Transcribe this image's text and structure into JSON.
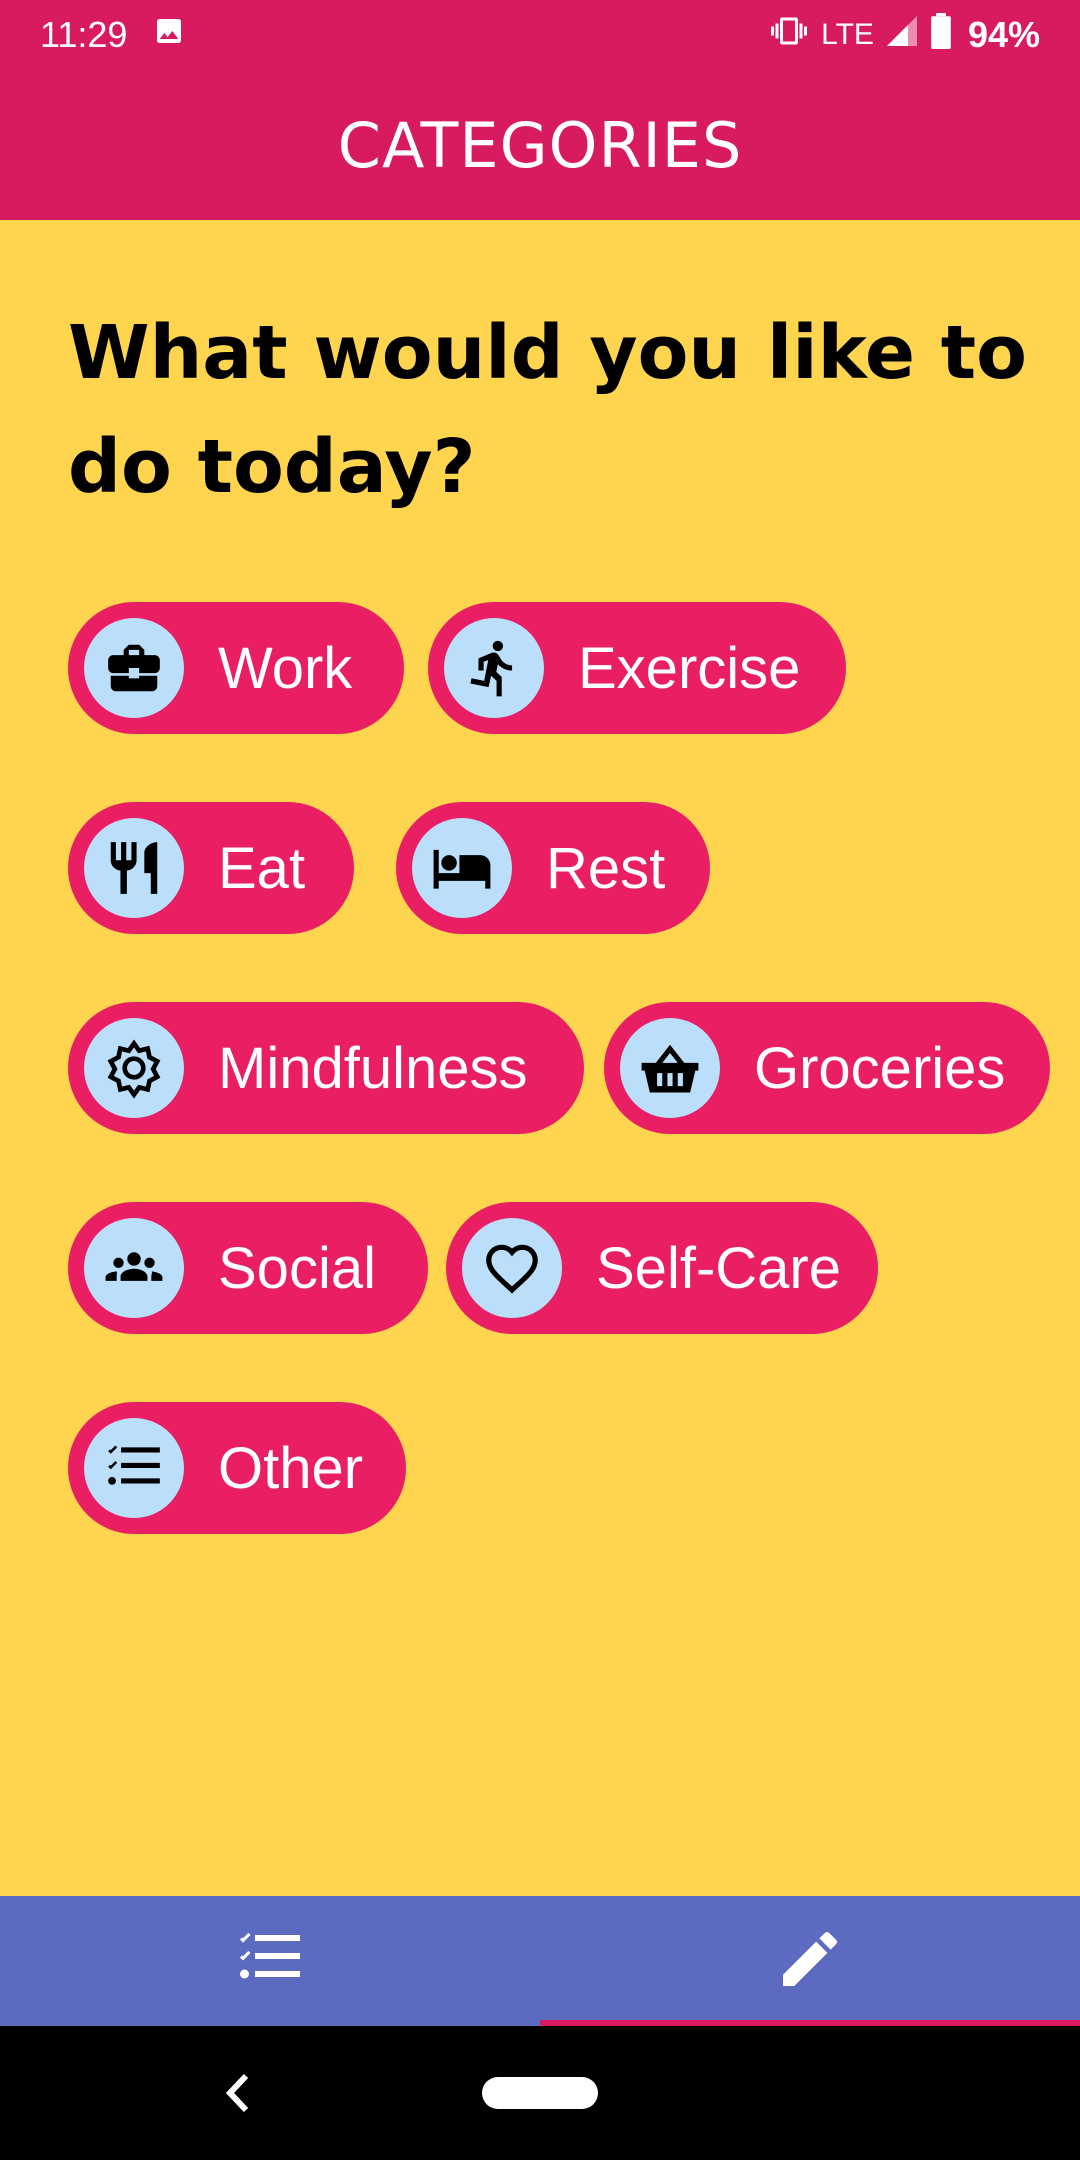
{
  "status_bar": {
    "time": "11:29",
    "network": "LTE",
    "battery": "94%",
    "icons": [
      "image-icon",
      "vibrate-icon",
      "signal-icon",
      "battery-icon"
    ]
  },
  "app_bar": {
    "title": "CATEGORIES"
  },
  "main": {
    "question": "What would you like to do today?",
    "categories": [
      {
        "label": "Work",
        "icon": "briefcase-icon"
      },
      {
        "label": "Exercise",
        "icon": "running-icon"
      },
      {
        "label": "Eat",
        "icon": "fork-knife-icon"
      },
      {
        "label": "Rest",
        "icon": "bed-icon"
      },
      {
        "label": "Mindfulness",
        "icon": "gear-icon"
      },
      {
        "label": "Groceries",
        "icon": "basket-icon"
      },
      {
        "label": "Social",
        "icon": "group-icon"
      },
      {
        "label": "Self-Care",
        "icon": "heart-icon"
      },
      {
        "label": "Other",
        "icon": "checklist-icon"
      }
    ]
  },
  "bottom_nav": {
    "items": [
      {
        "icon": "checklist-icon",
        "selected": false
      },
      {
        "icon": "pencil-icon",
        "selected": true
      }
    ]
  },
  "colors": {
    "primary": "#D81B60",
    "chip": "#E91E63",
    "background": "#FFD54F",
    "icon_bg": "#BBDEFB",
    "nav": "#5C6BC0"
  }
}
